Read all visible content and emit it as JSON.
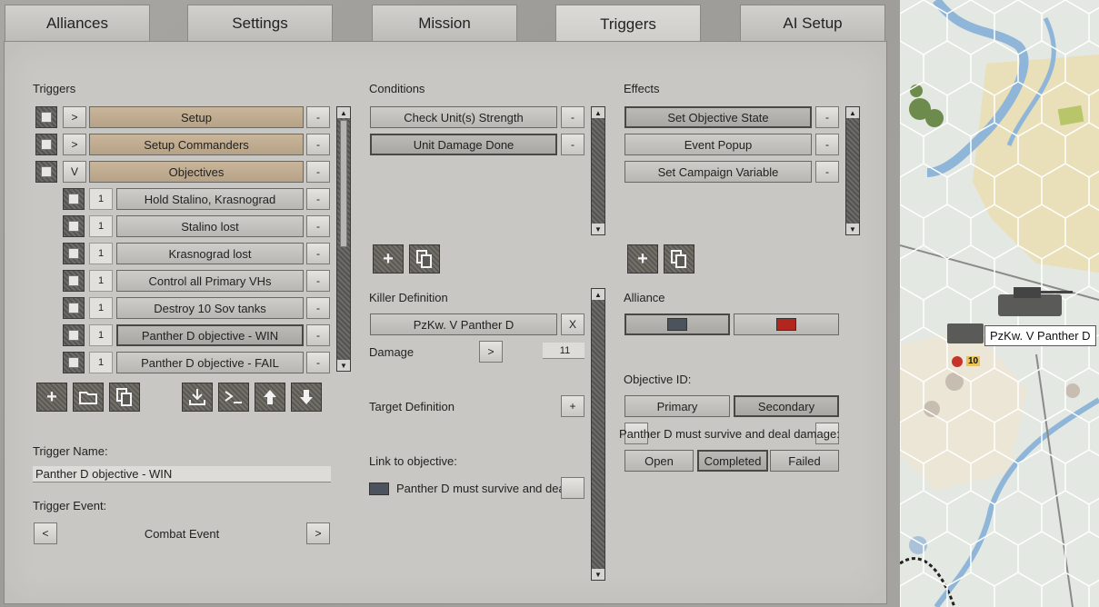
{
  "tabs": [
    "Alliances",
    "Settings",
    "Mission",
    "Triggers",
    "AI Setup"
  ],
  "triggers": {
    "heading": "Triggers",
    "groups": [
      {
        "toggle": ">",
        "label": "Setup"
      },
      {
        "toggle": ">",
        "label": "Setup Commanders"
      },
      {
        "toggle": "V",
        "label": "Objectives"
      }
    ],
    "items": [
      {
        "count": "1",
        "label": "Hold Stalino, Krasnograd"
      },
      {
        "count": "1",
        "label": "Stalino lost"
      },
      {
        "count": "1",
        "label": "Krasnograd lost"
      },
      {
        "count": "1",
        "label": "Control all Primary VHs"
      },
      {
        "count": "1",
        "label": "Destroy 10 Sov tanks"
      },
      {
        "count": "1",
        "label": "Panther D  objective - WIN"
      },
      {
        "count": "1",
        "label": "Panther D  objective - FAIL"
      }
    ],
    "minus": "-",
    "name_label": "Trigger Name:",
    "name_value": "Panther D  objective - WIN",
    "event_label": "Trigger Event:",
    "event_value": "Combat Event",
    "prev": "<",
    "next": ">"
  },
  "conditions": {
    "heading": "Conditions",
    "items": [
      "Check Unit(s) Strength",
      "Unit Damage Done"
    ],
    "minus": "-",
    "killer_label": "Killer Definition",
    "killer_value": "PzKw. V Panther D",
    "killer_clear": "X",
    "damage_label": "Damage",
    "damage_btn": ">",
    "damage_value": "11",
    "target_label": "Target Definition",
    "target_btn": "+",
    "link_label": "Link to objective:",
    "link_value": "Panther D must survive and deal da"
  },
  "effects": {
    "heading": "Effects",
    "items": [
      "Set Objective State",
      "Event Popup",
      "Set Campaign Variable"
    ],
    "minus": "-",
    "alliance_label": "Alliance",
    "alliance_colors": [
      "#4c535d",
      "#b3261e"
    ],
    "objective_id_label": "Objective ID:",
    "primary": "Primary",
    "secondary": "Secondary",
    "objective_text": "Panther D must survive and deal damage:",
    "open": "Open",
    "completed": "Completed",
    "failed": "Failed"
  },
  "map": {
    "tooltip": "PzKw. V Panther D",
    "unit_strength": "10"
  },
  "colors": {
    "tan": "#c2ae92",
    "panel": "#c9c7c3",
    "river": "#8fb6d8"
  }
}
